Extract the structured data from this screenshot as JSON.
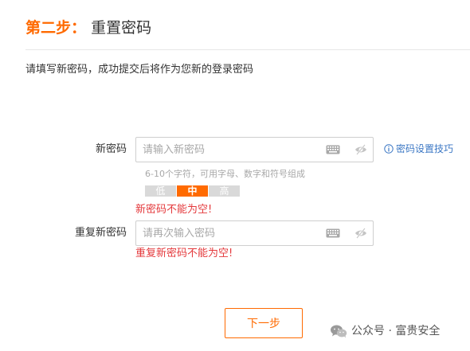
{
  "header": {
    "step_number": "第二步：",
    "step_title": "重置密码"
  },
  "instruction": "请填写新密码，成功提交后将作为您新的登录密码",
  "new_password": {
    "label": "新密码",
    "placeholder": "请输入新密码",
    "value": "",
    "keyboard_icon": "keyboard-icon",
    "visibility_icon": "eye-off-icon",
    "tip_label": "密码设置技巧",
    "tip_icon": "info-icon",
    "hint": "6-10个字符，可用字母、数字和符号组成",
    "strength": {
      "levels": [
        "低",
        "中",
        "高"
      ],
      "current": "中"
    },
    "error": "新密码不能为空!"
  },
  "confirm_password": {
    "label": "重复新密码",
    "placeholder": "请再次输入密码",
    "value": "",
    "keyboard_icon": "keyboard-icon",
    "visibility_icon": "eye-off-icon",
    "error": "重复新密码不能为空!"
  },
  "actions": {
    "next_label": "下一步"
  },
  "watermark": {
    "text": "公众号 · 富贵安全",
    "icon": "wechat-icon"
  },
  "colors": {
    "accent": "#ff6a00",
    "error": "#e4393c",
    "link": "#3b77c4",
    "border": "#cfcfcf",
    "muted": "#a8a8a8"
  }
}
